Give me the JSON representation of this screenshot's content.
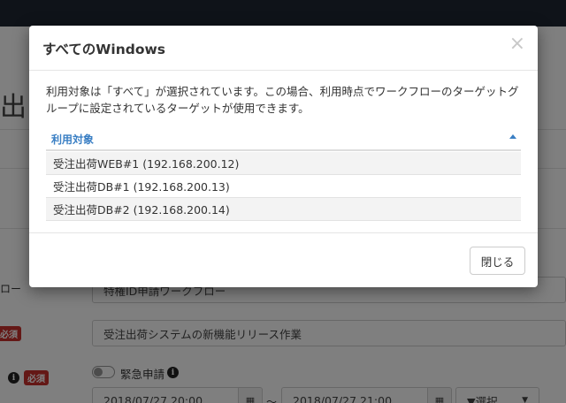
{
  "background": {
    "page_title_fragment": "出申",
    "labels": {
      "workflow_label_fragment": "ロー",
      "row4_label_fragment": "i"
    },
    "required_badge": "必須",
    "workflow_value": "特権ID申請ワークフロー",
    "task_name_value": "受注出荷システムの新機能リリース作業",
    "emergency_label": "緊急申請",
    "start_datetime": "2018/07/27 20:00",
    "range_separator": "～",
    "end_datetime": "2018/07/27 21:00",
    "select_placeholder": "▼選択"
  },
  "modal": {
    "title": "すべてのWindows",
    "close_glyph": "×",
    "description": "利用対象は「すべて」が選択されています。この場合、利用時点でワークフローのターゲットグループに設定されているターゲットが使用できます。",
    "column_header": "利用対象",
    "rows": [
      "受注出荷WEB#1 (192.168.200.12)",
      "受注出荷DB#1 (192.168.200.13)",
      "受注出荷DB#2 (192.168.200.14)"
    ],
    "close_button_label": "閉じる"
  },
  "colors": {
    "accent_blue": "#3a7fc4",
    "required_red": "#c9302c",
    "nav_dark": "#1e2733"
  }
}
